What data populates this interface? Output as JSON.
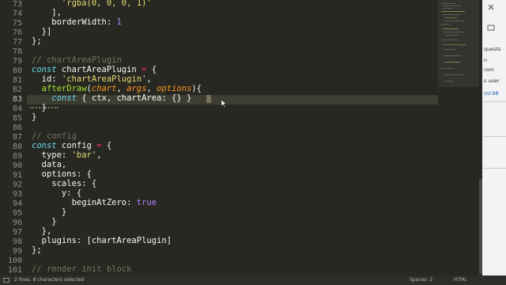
{
  "editor": {
    "line_numbers": [
      "73",
      "74",
      "75",
      "76",
      "77",
      "78",
      "79",
      "80",
      "81",
      "82",
      "83",
      "84",
      "85",
      "86",
      "87",
      "88",
      "89",
      "90",
      "91",
      "92",
      "93",
      "94",
      "95",
      "96",
      "97",
      "98",
      "99",
      "100",
      "101"
    ],
    "active_line": "83",
    "code": {
      "l73": "      'rgba(0, 0, 0, 1)'",
      "l74_a": "    ],",
      "l75_a": "    borderWidth: ",
      "l75_n": "1",
      "l76": "  }]",
      "l77": "};",
      "l79": "// chartAreaPlugin",
      "l80_k": "const",
      "l80_a": " chartAreaPlugin ",
      "l80_o": "=",
      "l80_b": " {",
      "l81_a": "  id: ",
      "l81_s": "'chartAreaPlugin'",
      "l81_b": ",",
      "l82_f": "  afterDraw",
      "l82_a": "(",
      "l82_p1": "chart",
      "l82_b": ", ",
      "l82_p2": "args",
      "l82_c": ", ",
      "l82_p3": "options",
      "l82_d": "){",
      "l83_k": "    const",
      "l83_a": " { ctx, chartArea: {} }",
      "l84": "  }",
      "l85": "}",
      "l87": "// config",
      "l88_k": "const",
      "l88_a": " config ",
      "l88_o": "=",
      "l88_b": " {",
      "l89_a": "  type: ",
      "l89_s": "'bar'",
      "l89_b": ",",
      "l90": "  data,",
      "l91": "  options: {",
      "l92": "    scales: {",
      "l93": "      y: {",
      "l94_a": "        beginAtZero: ",
      "l94_t": "true",
      "l95": "      }",
      "l96": "    }",
      "l97": "  },",
      "l98": "  plugins: [chartAreaPlugin]",
      "l99": "};",
      "l101": "// render init block"
    }
  },
  "devtools": {
    "fragments": [
      "quests",
      "n",
      "rom",
      "s user",
      "ml:98"
    ]
  },
  "statusbar": {
    "selection": "2 lines, 8 characters selected",
    "spaces": "Spaces: 2",
    "syntax": "HTML"
  },
  "colors": {
    "background": "#272822",
    "keyword": "#66d9ef",
    "string": "#e6db74",
    "number": "#ae81ff",
    "comment": "#75715e",
    "function": "#a6e22e",
    "parameter": "#fd971f",
    "operator": "#f92672"
  }
}
